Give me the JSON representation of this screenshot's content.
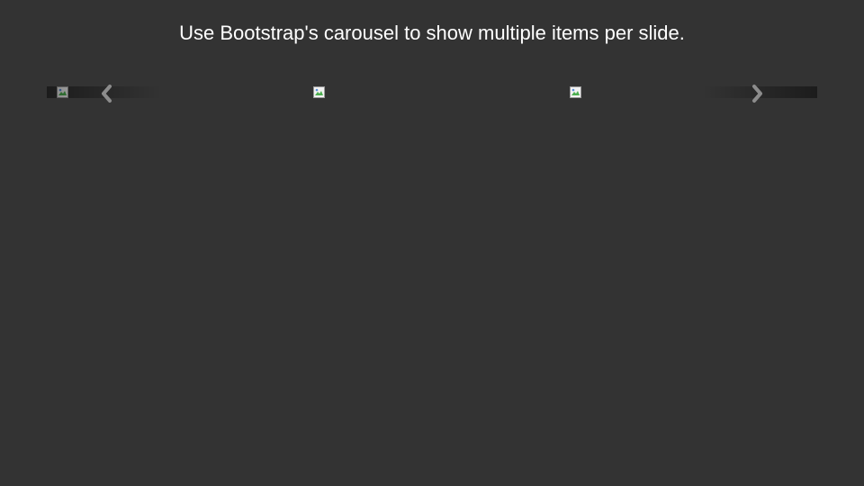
{
  "heading": "Use Bootstrap's carousel to show multiple items per slide.",
  "carousel": {
    "items": [
      {
        "image_icon": "broken-image-icon"
      },
      {
        "image_icon": "broken-image-icon"
      },
      {
        "image_icon": "broken-image-icon"
      }
    ],
    "prev_icon": "chevron-left-icon",
    "next_icon": "chevron-right-icon"
  },
  "colors": {
    "background": "#333333",
    "text": "#ffffff",
    "chevron": "#8c8c8c"
  }
}
